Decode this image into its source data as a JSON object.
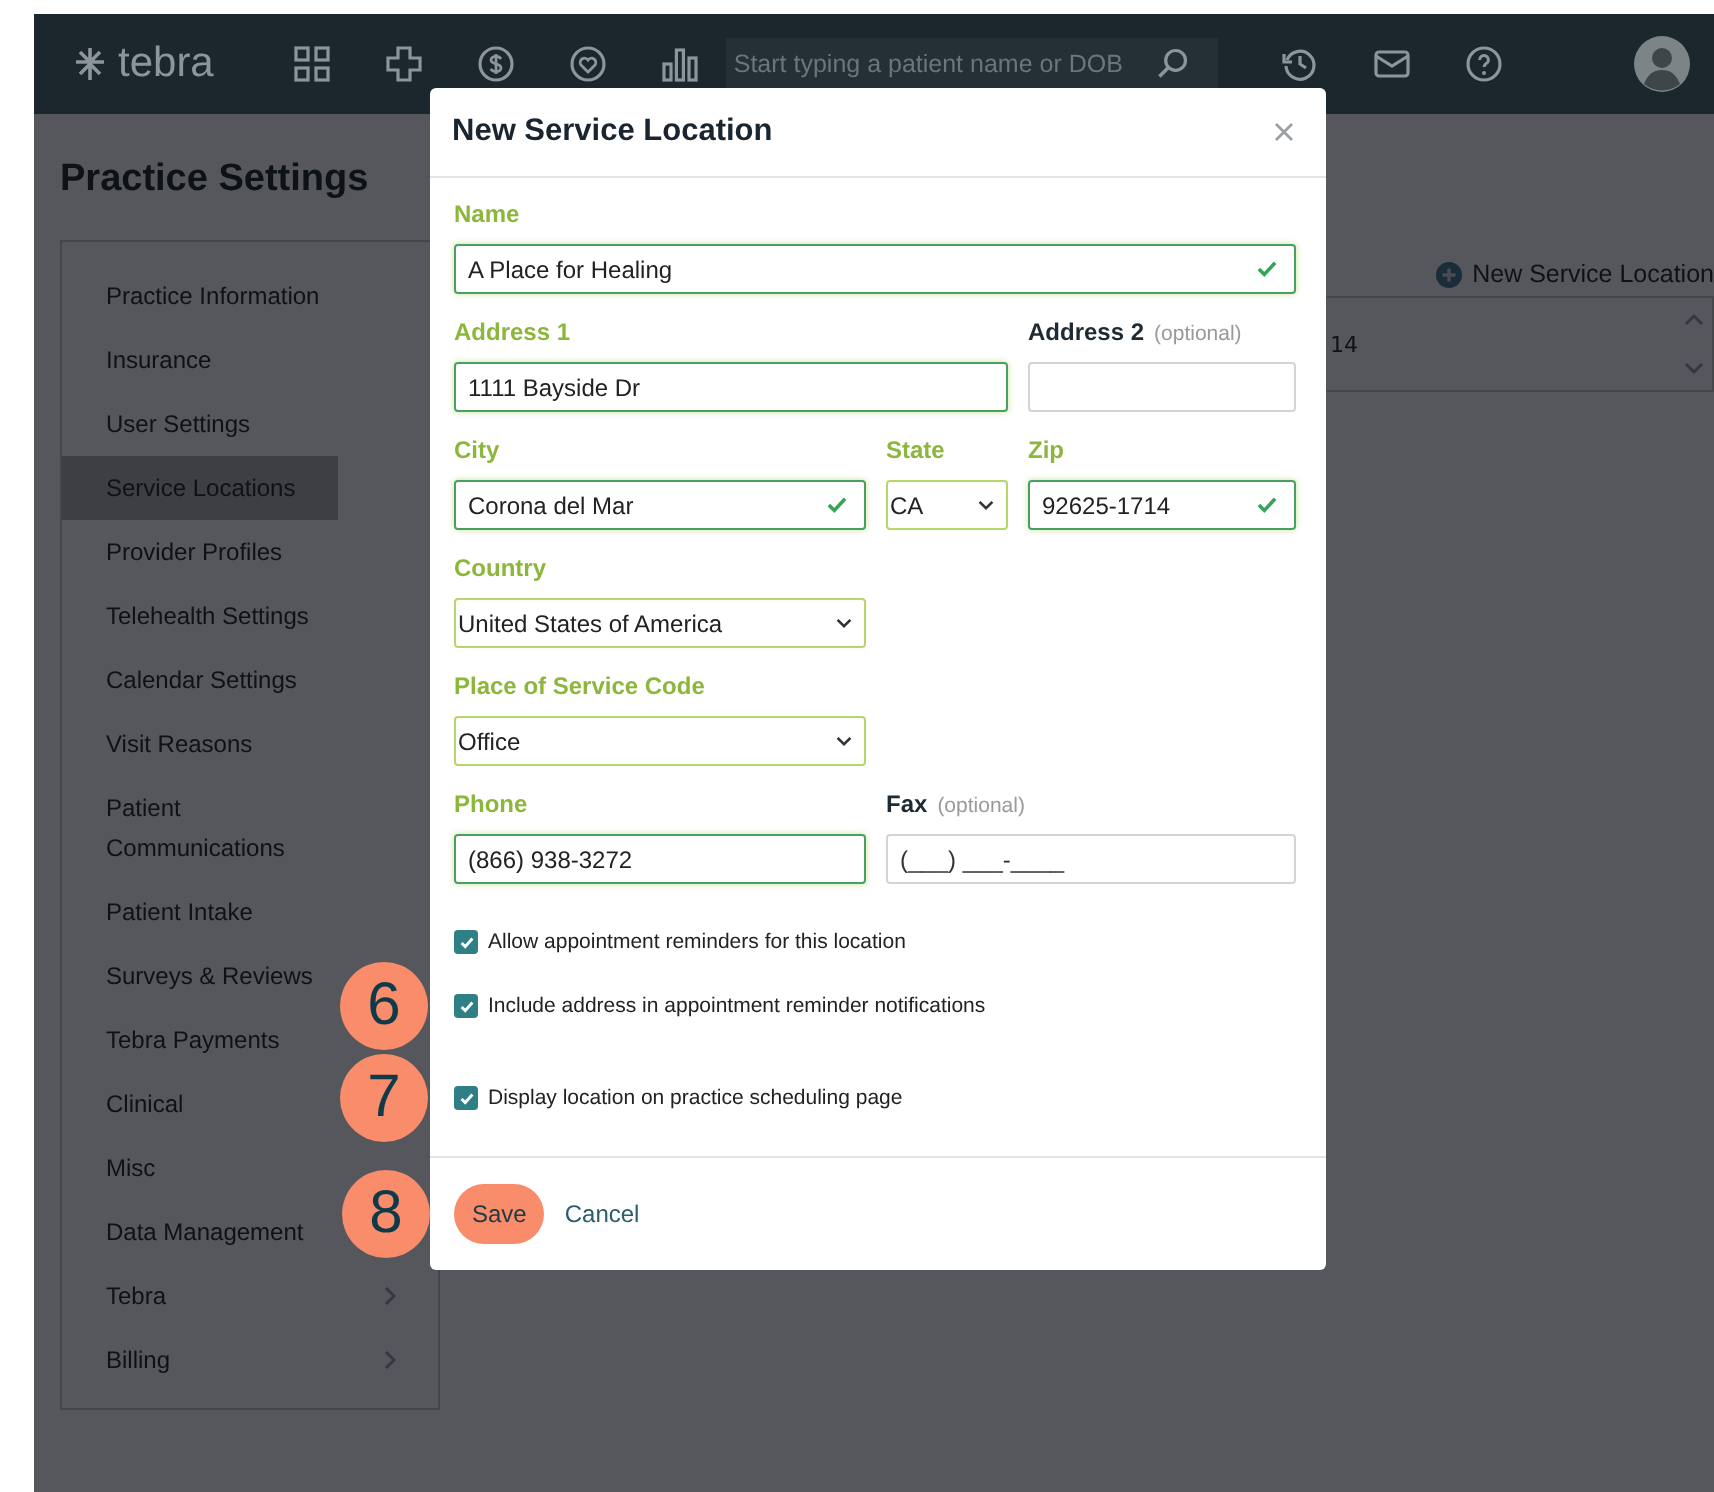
{
  "topbar": {
    "logo": "tebra",
    "search": {
      "placeholder": "Start typing a patient name or DOB"
    }
  },
  "page_title": "Practice Settings",
  "sidebar": {
    "items": [
      {
        "label": "Practice Information",
        "selected": false,
        "submenu": false
      },
      {
        "label": "Insurance",
        "selected": false,
        "submenu": false
      },
      {
        "label": "User Settings",
        "selected": false,
        "submenu": false
      },
      {
        "label": "Service Locations",
        "selected": true,
        "submenu": false
      },
      {
        "label": "Provider Profiles",
        "selected": false,
        "submenu": false
      },
      {
        "label": "Telehealth Settings",
        "selected": false,
        "submenu": false
      },
      {
        "label": "Calendar Settings",
        "selected": false,
        "submenu": false
      },
      {
        "label": "Visit Reasons",
        "selected": false,
        "submenu": false
      },
      {
        "label": "Patient Communications",
        "selected": false,
        "submenu": false
      },
      {
        "label": "Patient Intake",
        "selected": false,
        "submenu": false
      },
      {
        "label": "Surveys & Reviews",
        "selected": false,
        "submenu": false
      },
      {
        "label": "Tebra Payments",
        "selected": false,
        "submenu": false
      },
      {
        "label": "Clinical",
        "selected": false,
        "submenu": false
      },
      {
        "label": "Misc",
        "selected": false,
        "submenu": false
      },
      {
        "label": "Data Management",
        "selected": false,
        "submenu": false
      },
      {
        "label": "Tebra",
        "selected": false,
        "submenu": true
      },
      {
        "label": "Billing",
        "selected": false,
        "submenu": true
      }
    ]
  },
  "new_location_button": "New Service Location",
  "table": {
    "cell": "14"
  },
  "modal": {
    "title": "New Service Location",
    "fields": [
      {
        "kind": "text",
        "label": "Name",
        "value": "A Place for Healing",
        "valid": true,
        "required": true
      },
      {
        "kind": "text",
        "label": "Address 1",
        "value": "1111 Bayside Dr",
        "valid": false,
        "required": true
      },
      {
        "kind": "text",
        "label": "Address 2",
        "optional": "(optional)",
        "required": false,
        "valid": false
      },
      {
        "kind": "text",
        "label": "City",
        "value": "Corona del Mar",
        "valid": true,
        "required": true
      },
      {
        "kind": "select",
        "label": "State",
        "value": "CA",
        "required": true
      },
      {
        "kind": "text",
        "label": "Zip",
        "value": "92625-1714",
        "valid": true,
        "required": true
      },
      {
        "kind": "select",
        "label": "Country",
        "value": "United States of America",
        "required": true
      },
      {
        "kind": "select",
        "label": "Place of Service Code",
        "value": "Office",
        "required": true
      },
      {
        "kind": "text",
        "label": "Phone",
        "value": "(866) 938-3272",
        "valid": false,
        "required": true
      },
      {
        "kind": "text",
        "label": "Fax",
        "optional": "(optional)",
        "placeholder": "(___) ___-____",
        "required": false,
        "valid": false
      }
    ],
    "checkboxes": [
      {
        "label": "Allow appointment reminders for this location",
        "checked": true
      },
      {
        "label": "Include address in appointment reminder notifications",
        "checked": true,
        "callout": "6"
      },
      {
        "label": "Display location on practice scheduling page",
        "checked": true,
        "callout": "7"
      }
    ],
    "save_button": {
      "label": "Save",
      "callout": "8"
    },
    "cancel_link": "Cancel"
  }
}
